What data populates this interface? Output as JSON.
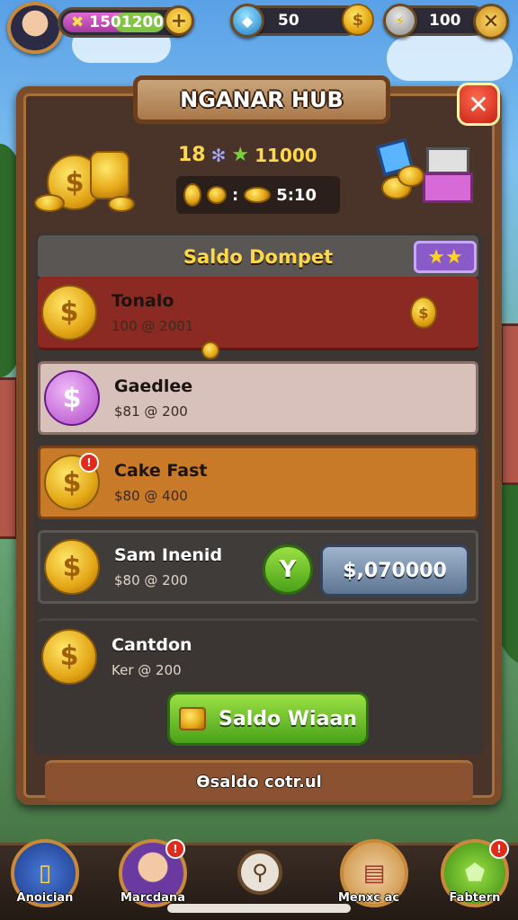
{
  "hud": {
    "gold_amount": "1501200",
    "gold_plus_label": "+",
    "gems_amount": "50",
    "energy_amount": "100",
    "close_label": "✕"
  },
  "panel": {
    "title": "NGANAR HUB",
    "close_label": "✕",
    "stats": {
      "level": "18",
      "score": "11000",
      "rate_separator": ":",
      "rate_value": "5:10"
    },
    "section_title": "Saldo Dompet",
    "section_stars": "★★",
    "rows": [
      {
        "name": "Tonalo",
        "sub": "100 @ 2001",
        "has_badge": false
      },
      {
        "name": "Gaedlee",
        "sub": "$81 @ 200",
        "has_badge": false
      },
      {
        "name": "Cake Fast",
        "sub": "$80 @ 400",
        "has_badge": true
      },
      {
        "name": "Sam Inenid",
        "sub": "$80 @ 200",
        "has_badge": false
      },
      {
        "name": "Cantdon",
        "sub": "Ker @ 200",
        "has_badge": false
      }
    ],
    "row_badge": "!",
    "confirm_label": "Y",
    "amount_label": "$,070000",
    "primary_button": "Saldo Wiaan",
    "footer_text": "Ɵsaldo cotr.ul"
  },
  "nav": {
    "items": [
      {
        "label": "Anoician",
        "icon": "shop-icon",
        "badge": ""
      },
      {
        "label": "Marcdana",
        "icon": "profile-icon",
        "badge": "!"
      },
      {
        "label": "",
        "icon": "search-icon",
        "badge": ""
      },
      {
        "label": "Menxc ac",
        "icon": "notes-icon",
        "badge": ""
      },
      {
        "label": "Fabtern",
        "icon": "map-icon",
        "badge": "!"
      }
    ]
  },
  "colors": {
    "row_red": "#8b2a22",
    "row_pink": "#d8c0bb",
    "row_orange": "#c87a28",
    "row_dark": "#3f3c3a",
    "accent_gold": "#ffd84a"
  }
}
